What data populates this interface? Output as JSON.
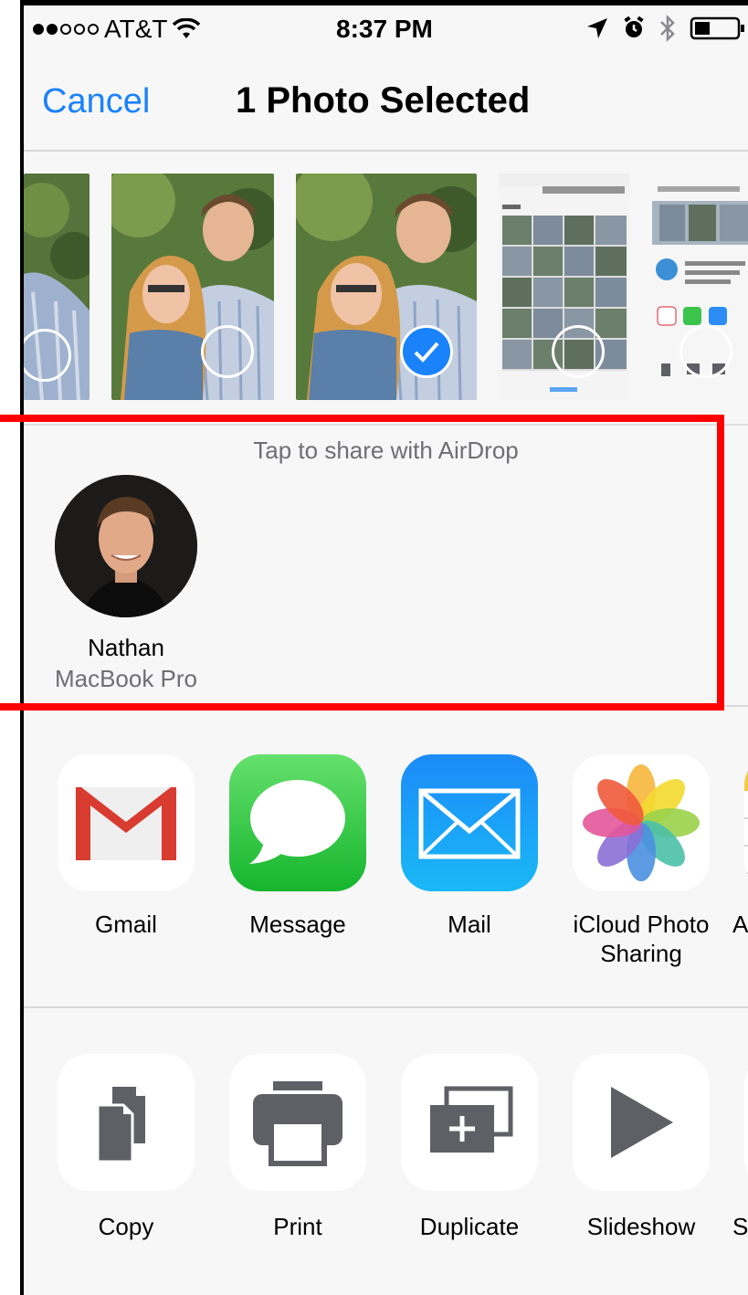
{
  "status": {
    "carrier": "AT&T",
    "signal_bars": [
      true,
      true,
      false,
      false,
      false
    ],
    "time": "8:37 PM",
    "icons": [
      "location-icon",
      "alarm-icon",
      "bluetooth-icon",
      "battery-icon"
    ]
  },
  "nav": {
    "cancel_label": "Cancel",
    "title": "1 Photo Selected"
  },
  "photos": [
    {
      "kind": "portrait-crop",
      "selected": false
    },
    {
      "kind": "couple-portrait",
      "selected": false
    },
    {
      "kind": "couple-portrait",
      "selected": true
    },
    {
      "kind": "screenshot-photos",
      "selected": false
    },
    {
      "kind": "screenshot-share",
      "selected": false
    }
  ],
  "airdrop": {
    "hint": "Tap to share with AirDrop",
    "people": [
      {
        "name": "Nathan",
        "device": "MacBook Pro"
      }
    ]
  },
  "share_apps": [
    {
      "label": "Gmail",
      "icon": "gmail-icon"
    },
    {
      "label": "Message",
      "icon": "message-icon"
    },
    {
      "label": "Mail",
      "icon": "mail-icon"
    },
    {
      "label": "iCloud Photo Sharing",
      "icon": "icloud-photos-icon"
    },
    {
      "label": "A",
      "icon": "notes-icon"
    }
  ],
  "actions": [
    {
      "label": "Copy",
      "icon": "copy-icon"
    },
    {
      "label": "Print",
      "icon": "print-icon"
    },
    {
      "label": "Duplicate",
      "icon": "duplicate-icon"
    },
    {
      "label": "Slideshow",
      "icon": "slideshow-icon"
    },
    {
      "label": "S",
      "icon": "more-action-icon"
    }
  ],
  "colors": {
    "accent": "#1a82fb",
    "highlight": "#ff0000",
    "background": "#f7f7f7",
    "secondary_text": "#6e6e73",
    "action_glyph": "#5f5f66"
  }
}
